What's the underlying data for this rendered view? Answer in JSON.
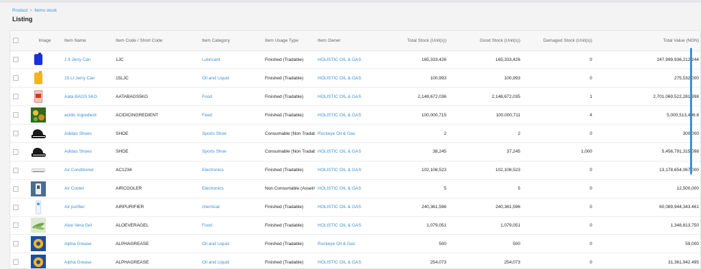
{
  "breadcrumb": {
    "items": [
      "Product",
      "Items stock"
    ],
    "separator": ">"
  },
  "page": {
    "title": "Listing"
  },
  "colors": {
    "link": "#3d8fd1",
    "scrollbar": "#3d8fd1"
  },
  "table": {
    "columns": [
      "Image",
      "Item Name",
      "Item Code / Short Code",
      "Item Category",
      "Item Usage Type",
      "Item Owner",
      "Total Stock (Unit(s))",
      "Good Stock (Unit(s))",
      "Damaged Stock (Unit(s))",
      "Total Value (NGN)"
    ],
    "rows": [
      {
        "thumb": "blue-jerry-can-icon",
        "name": "1 lt Jerry Can",
        "code": "1JC",
        "category": "Lubricant",
        "usage": "Finished (Tradable)",
        "owner": "HOLISTIC OIL & GAS",
        "total": "165,333,426",
        "good": "165,333,426",
        "damaged": "0",
        "value": "247,999,936,212.244"
      },
      {
        "thumb": "yellow-jerry-can-icon",
        "name": "15 Lt Jerry Can",
        "code": "15LJC",
        "category": "Oil and Liquid",
        "usage": "Finished (Tradable)",
        "owner": "HOLISTIC OIL & GAS",
        "total": "100,993",
        "good": "100,993",
        "damaged": "0",
        "value": "275,532,000"
      },
      {
        "thumb": "bag-icon",
        "name": "Aata BAGS 5KG",
        "code": "AATABAGS5KG",
        "category": "Food",
        "usage": "Finished (Tradable)",
        "owner": "HOLISTIC OIL & GAS",
        "total": "2,148,672,036",
        "good": "2,148,672,035",
        "damaged": "1",
        "value": "2,701,069,522,281.998"
      },
      {
        "thumb": "ingredient-icon",
        "name": "acidic ingredient",
        "code": "ACIDICINGREDIENT",
        "category": "Feed",
        "usage": "Finished (Tradable)",
        "owner": "HOLISTIC OIL & GAS",
        "total": "100,000,715",
        "good": "100,000,711",
        "damaged": "4",
        "value": "5,000,513,498.8"
      },
      {
        "thumb": "shoe-icon",
        "name": "Adidas Shoes",
        "code": "SHOE",
        "category": "Sports Shoe",
        "usage": "Consumable (Non Tradable)",
        "owner": "Rockeye Oil & Gas",
        "total": "2",
        "good": "2",
        "damaged": "0",
        "value": "300,000"
      },
      {
        "thumb": "shoe-icon",
        "name": "Adidas Shoes",
        "code": "SHOE",
        "category": "Sports Shoe",
        "usage": "Consumable (Non Tradable)",
        "owner": "HOLISTIC OIL & GAS",
        "total": "38,245",
        "good": "37,245",
        "damaged": "1,000",
        "value": "5,456,791,315.098"
      },
      {
        "thumb": "air-conditioner-icon",
        "name": "Air Conditioner",
        "code": "AC1234",
        "category": "Electronics",
        "usage": "Finished (Tradable)",
        "owner": "HOLISTIC OIL & GAS",
        "total": "102,108,523",
        "good": "102,108,523",
        "damaged": "0",
        "value": "13,178,654,067,000"
      },
      {
        "thumb": "air-cooler-icon",
        "name": "Air Cooler",
        "code": "AIRCOOLER",
        "category": "Electronics",
        "usage": "Non Consumable (Asset/Capital)",
        "owner": "HOLISTIC OIL & GAS",
        "total": "5",
        "good": "5",
        "damaged": "0",
        "value": "12,500,000"
      },
      {
        "thumb": "air-purifier-icon",
        "name": "Air purifier",
        "code": "AIRPURIFIER",
        "category": "chemical",
        "usage": "Finished (Tradable)",
        "owner": "HOLISTIC OIL & GAS",
        "total": "240,361,596",
        "good": "240,361,596",
        "damaged": "0",
        "value": "60,089,944,343.461"
      },
      {
        "thumb": "aloe-vera-icon",
        "name": "Aloe Vera Gel",
        "code": "ALOEVERAGEL",
        "category": "Food",
        "usage": "Finished (Tradable)",
        "owner": "HOLISTIC OIL & GAS",
        "total": "1,079,051",
        "good": "1,079,051",
        "damaged": "0",
        "value": "1,348,813,750"
      },
      {
        "thumb": "grease-icon",
        "name": "Alpha Grease",
        "code": "ALPHAGREASE",
        "category": "Oil and Liquid",
        "usage": "Finished (Tradable)",
        "owner": "Rockeye Oil & Gas",
        "total": "500",
        "good": "500",
        "damaged": "0",
        "value": "59,000"
      },
      {
        "thumb": "grease-icon",
        "name": "Alpha Grease",
        "code": "ALPHAGREASE",
        "category": "Oil and Liquid",
        "usage": "Finished (Tradable)",
        "owner": "HOLISTIC OIL & GAS",
        "total": "254,073",
        "good": "254,073",
        "damaged": "0",
        "value": "31,361,942.495"
      }
    ]
  }
}
